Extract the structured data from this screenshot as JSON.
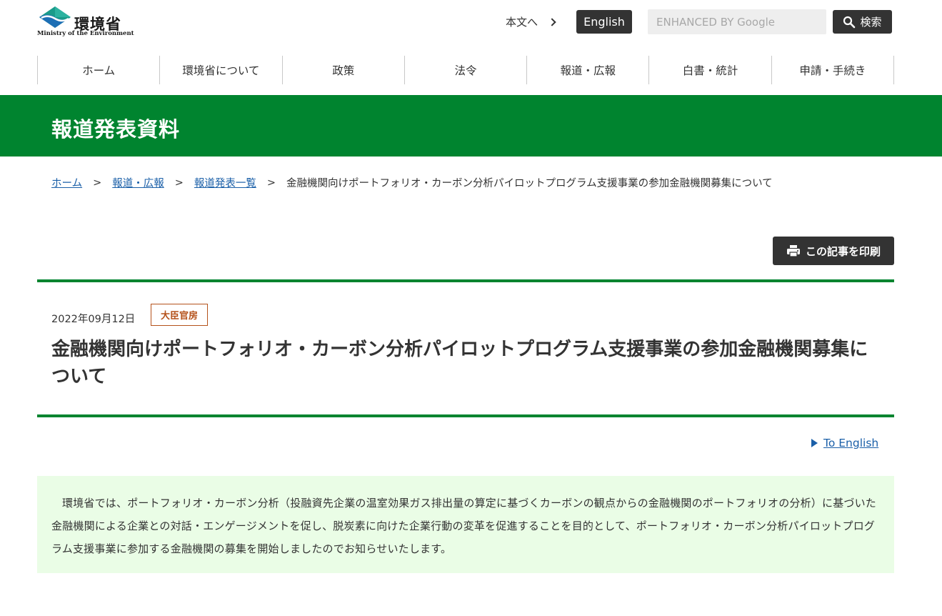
{
  "header": {
    "logo_text": "環境省",
    "logo_sub": "Ministry of the Environment",
    "skip_link": "本文へ",
    "english_button": "English",
    "search_placeholder": "ENHANCED BY Google",
    "search_button": "検索"
  },
  "nav": {
    "items": [
      {
        "label": "ホーム"
      },
      {
        "label": "環境省について"
      },
      {
        "label": "政策"
      },
      {
        "label": "法令"
      },
      {
        "label": "報道・広報"
      },
      {
        "label": "白書・統計"
      },
      {
        "label": "申請・手続き"
      }
    ]
  },
  "page": {
    "title": "報道発表資料"
  },
  "breadcrumb": {
    "items": [
      {
        "label": "ホーム"
      },
      {
        "label": "報道・広報"
      },
      {
        "label": "報道発表一覧"
      }
    ],
    "separator": ">",
    "current": "金融機関向けポートフォリオ・カーボン分析パイロットプログラム支援事業の参加金融機関募集について"
  },
  "toolbar": {
    "print_label": "この記事を印刷"
  },
  "article": {
    "date": "2022年09月12日",
    "tag": "大臣官房",
    "title": "金融機関向けポートフォリオ・カーボン分析パイロットプログラム支援事業の参加金融機関募集について",
    "to_english": "To English",
    "summary": "環境省では、ポートフォリオ・カーボン分析（投融資先企業の温室効果ガス排出量の算定に基づくカーボンの観点からの金融機関のポートフォリオの分析）に基づいた金融機関による企業との対話・エンゲージメントを促し、脱炭素に向けた企業行動の変革を促進することを目的として、ポートフォリオ・カーボン分析パイロットプログラム支援事業に参加する金融機関の募集を開始しましたのでお知らせいたします。"
  },
  "colors": {
    "brand_green": "#00842f",
    "dark_button": "#333333",
    "link_blue": "#1a5fa8",
    "tag_orange": "#b5521b",
    "summary_bg": "#eafde6"
  },
  "icons": {
    "logo": "moe-logo-icon",
    "skip": "chevron-right-icon",
    "search": "search-icon",
    "print": "printer-icon",
    "to_english": "triangle-right-icon"
  }
}
